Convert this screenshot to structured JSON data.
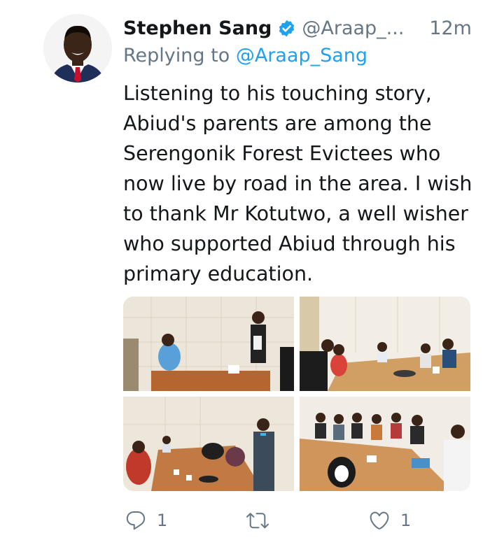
{
  "tweet": {
    "author_name": "Stephen Sang",
    "handle": "@Araap_...",
    "time": "12m",
    "reply_prefix": "Replying to ",
    "reply_to": "@Araap_Sang",
    "text": "Listening to his touching story, Abiud's parents are among the Serengonik Forest Evictees who now live by road in the area. I wish to thank Mr Kotutwo, a well wisher who supported Abiud through his primary education."
  },
  "media": [
    {
      "icon": "photo-office-meeting"
    },
    {
      "icon": "photo-conference-room"
    },
    {
      "icon": "photo-group-table"
    },
    {
      "icon": "photo-boardroom"
    }
  ],
  "actions": {
    "reply_count": "1",
    "retweet_count": "",
    "like_count": "1"
  },
  "colors": {
    "accent": "#1da1f2",
    "secondary_text": "#657786",
    "primary_text": "#14171a"
  }
}
